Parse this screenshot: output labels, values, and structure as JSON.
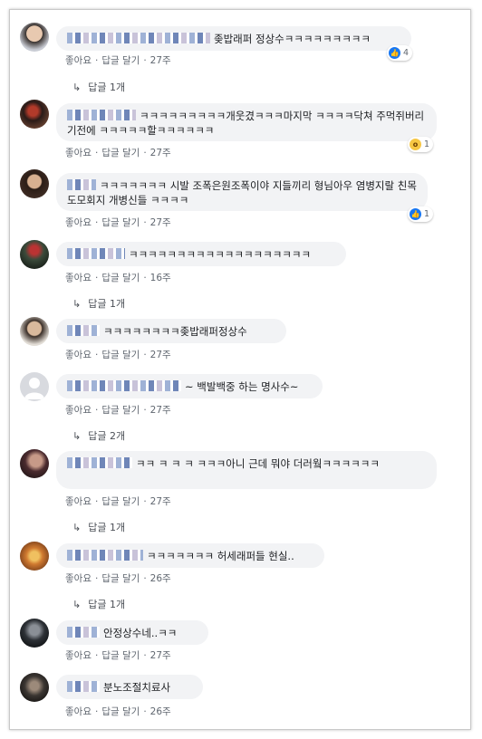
{
  "actions": {
    "like": "좋아요",
    "reply": "답글 달기"
  },
  "comments": [
    {
      "text": "좆밥래퍼 정상수ㅋㅋㅋㅋㅋㅋㅋㅋㅋ",
      "time": "27주",
      "reaction": {
        "type": "like-icon",
        "count": "4"
      },
      "replies": "답글 1개"
    },
    {
      "text": "ㅋㅋㅋㅋㅋㅋㅋㅋㅋ개웃겼ㅋㅋㅋ마지막 ㅋㅋㅋㅋ닥쳐 주먹쥐버리기전에 ㅋㅋㅋㅋㅋ할ㅋㅋㅋㅋㅋㅋ",
      "time": "27주",
      "reaction": {
        "type": "wow-icon",
        "count": "1"
      }
    },
    {
      "text": "ㅋㅋㅋㅋㅋㅋㅋ 시발 조폭은원조폭이야 지들끼리 형님아우 염병지랄 친목도모회지 개병신들 ㅋㅋㅋㅋ",
      "time": "27주",
      "reaction": {
        "type": "like-icon",
        "count": "1"
      }
    },
    {
      "text": "ㅋㅋㅋㅋㅋㅋㅋㅋㅋㅋㅋㅋㅋㅋㅋㅋㅋㅋㅋ",
      "time": "16주",
      "replies": "답글 1개"
    },
    {
      "text": "ㅋㅋㅋㅋㅋㅋㅋㅋ좆밥래퍼정상수",
      "time": "27주"
    },
    {
      "text": "~ 백발백중 하는 명사수~",
      "time": "27주",
      "replies": "답글 2개"
    },
    {
      "text": "ㅋㅋ ㅋ ㅋ ㅋ ㅋㅋㅋ아니 근데 뭐야 더러웤ㅋㅋㅋㅋㅋㅋ",
      "time": "27주",
      "replies": "답글 1개"
    },
    {
      "text": "ㅋㅋㅋㅋㅋㅋㅋ 허세래퍼들 현실..",
      "time": "26주",
      "replies": "답글 1개"
    },
    {
      "text": "안정상수네..ㅋㅋ",
      "time": "27주"
    },
    {
      "text": "분노조절치료사",
      "time": "26주"
    }
  ]
}
